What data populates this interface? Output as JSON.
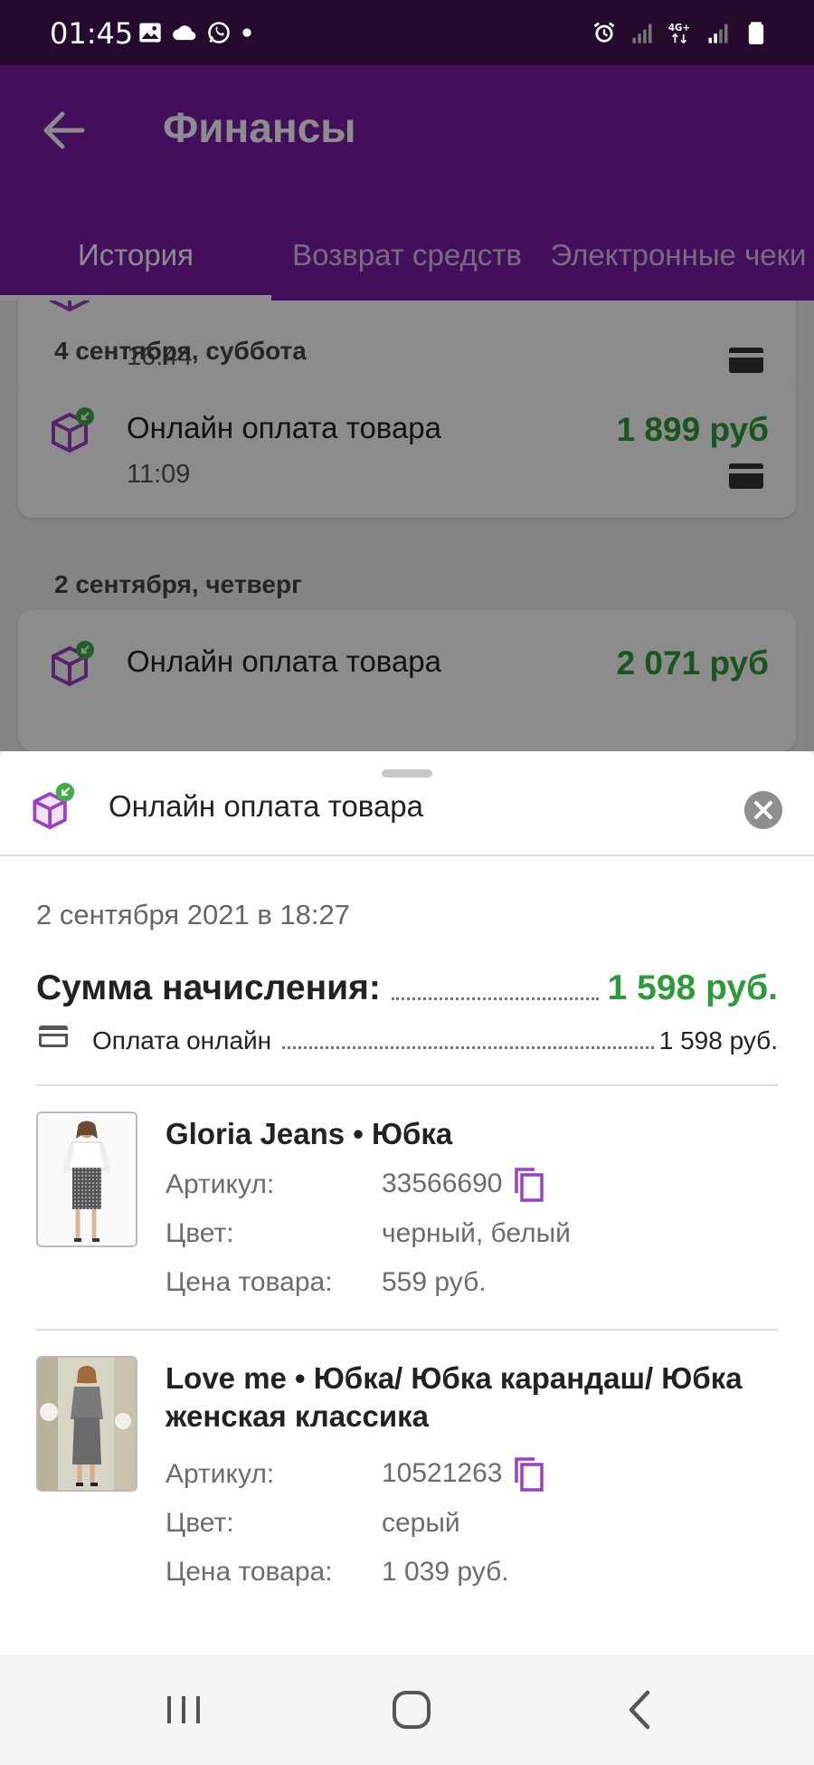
{
  "status_bar": {
    "time": "01:45",
    "left_icons": [
      "image-icon",
      "cloud-icon",
      "whatsapp-icon",
      "dot-icon"
    ],
    "right_icons": [
      "alarm-icon",
      "signal-icon",
      "network-4g-icon",
      "signal-icon",
      "battery-icon"
    ],
    "network_label": "4G+"
  },
  "appbar": {
    "title": "Финансы",
    "tabs": [
      {
        "label": "История",
        "active": true
      },
      {
        "label": "Возврат средств",
        "active": false
      },
      {
        "label": "Электронные чеки",
        "active": false
      }
    ]
  },
  "list": {
    "items": [
      {
        "time": "16:44"
      },
      {
        "date_header": "4 сентября, суббота",
        "title": "Онлайн оплата товара",
        "time": "11:09",
        "amount": "1 899 руб"
      },
      {
        "date_header": "2 сентября, четверг",
        "title": "Онлайн оплата товара",
        "amount": "2 071 руб"
      }
    ]
  },
  "sheet": {
    "title": "Онлайн оплата товара",
    "datetime": "2 сентября 2021 в 18:27",
    "sum_label": "Сумма начисления:",
    "sum_value": "1 598 руб.",
    "payment_label": "Оплата онлайн",
    "payment_value": "1 598 руб.",
    "labels": {
      "article": "Артикул:",
      "color": "Цвет:",
      "price": "Цена товара:"
    },
    "products": [
      {
        "title": "Gloria Jeans • Юбка",
        "article": "33566690",
        "color": "черный, белый",
        "price": "559 руб."
      },
      {
        "title": "Love me • Юбка/ Юбка карандаш/ Юбка женская классика",
        "article": "10521263",
        "color": "серый",
        "price": "1 039 руб."
      }
    ]
  },
  "colors": {
    "brand_purple": "#7b1aa8",
    "amount_green": "#2e9b3a",
    "icon_purple": "#9b3fc4"
  }
}
